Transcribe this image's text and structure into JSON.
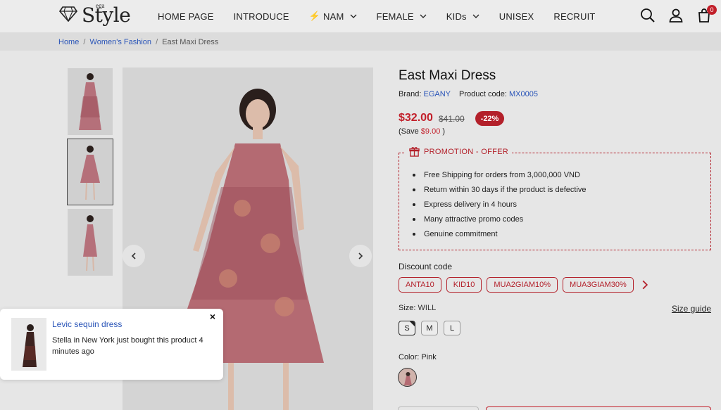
{
  "logo": {
    "small": "ega",
    "main": "Style"
  },
  "nav": [
    {
      "label": "HOME PAGE",
      "dropdown": false,
      "flash": false
    },
    {
      "label": "INTRODUCE",
      "dropdown": false,
      "flash": false
    },
    {
      "label": "NAM",
      "dropdown": true,
      "flash": true
    },
    {
      "label": "FEMALE",
      "dropdown": true,
      "flash": false
    },
    {
      "label": "KIDs",
      "dropdown": true,
      "flash": false
    },
    {
      "label": "UNISEX",
      "dropdown": false,
      "flash": false
    },
    {
      "label": "RECRUIT",
      "dropdown": false,
      "flash": false
    }
  ],
  "header_icons": [
    "search-icon",
    "user-icon",
    "cart-icon"
  ],
  "cart_count": "0",
  "breadcrumb": {
    "home": "Home",
    "category": "Women's Fashion",
    "current": "East Maxi Dress",
    "sep": "/"
  },
  "product": {
    "title": "East Maxi Dress",
    "brand_label": "Brand:",
    "brand": "EGANY",
    "code_label": "Product code:",
    "code": "MX0005",
    "price": "$32.00",
    "old_price": "$41.00",
    "discount": "-22%",
    "save_prefix": "(Save",
    "save_amount": "$9.00",
    "save_suffix": ")"
  },
  "promotion": {
    "title": "PROMOTION - OFFER",
    "items": [
      "Free Shipping for orders from 3,000,000 VND",
      "Return within 30 days if the product is defective",
      "Express delivery in 4 hours",
      "Many attractive promo codes",
      "Genuine commitment"
    ]
  },
  "discount_codes": {
    "title": "Discount code",
    "codes": [
      "ANTA10",
      "KID10",
      "MUA2GIAM10%",
      "MUA3GIAM30%"
    ]
  },
  "size": {
    "label": "Size:",
    "value": "WILL",
    "guide": "Size guide",
    "options": [
      "S",
      "M",
      "L"
    ],
    "selected": "S"
  },
  "color": {
    "label": "Color:",
    "value": "Pink"
  },
  "notification": {
    "title": "Levic sequin dress",
    "text": "Stella in New York just bought this product 4 minutes ago",
    "close": "×"
  },
  "colors": {
    "accent_red": "#c21f2a",
    "link_blue": "#2a55b8"
  }
}
